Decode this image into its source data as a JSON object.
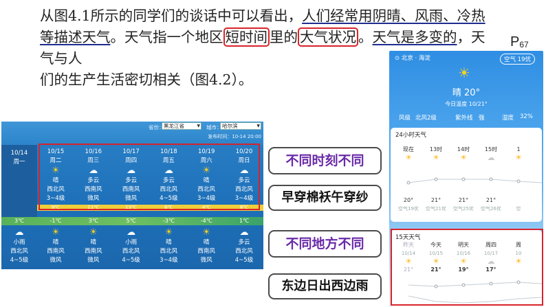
{
  "paragraph": {
    "s1": "从图4.1所示的同学们的谈话中可以看出，",
    "s1_ul": "人们经常用阴晴、风雨、冷热",
    "s2_ul": "等描述天气",
    "s2": "。天气指一个地区",
    "box1": "短时间",
    "s3": "里的",
    "box2": "大气状况",
    "s4": "。",
    "s4_ul": "天气是多变的",
    "s5": "，天气与人",
    "s6": "们的生产生活密切相关（图4.2）。"
  },
  "page_number": {
    "p": "P",
    "sub": "67"
  },
  "forecast": {
    "province_label": "省份：",
    "province_value": "黑龙江省",
    "city_label": "城市：",
    "city_value": "哈尔滨",
    "publish_time": "发布时间：10-14 20:00",
    "today": {
      "date": "10/14",
      "weekday": "周一"
    },
    "days": [
      {
        "date": "10/15",
        "weekday": "周二",
        "icon": "sun-icon",
        "weather": "晴",
        "wind": "西北风",
        "level": "3~4级",
        "high": "9℃",
        "low": "-1℃",
        "n_icon": "sun-icon",
        "n_weather": "晴",
        "n_wind": "西南风",
        "n_level": "微风"
      },
      {
        "date": "10/16",
        "weekday": "周三",
        "icon": "cloud-icon",
        "weather": "多云",
        "wind": "西南风",
        "level": "微风",
        "high": "11℃",
        "low": "3℃",
        "n_icon": "sun-icon",
        "n_weather": "晴",
        "n_wind": "西南风",
        "n_level": "微风"
      },
      {
        "date": "10/17",
        "weekday": "周四",
        "icon": "cloud-icon",
        "weather": "多云",
        "wind": "西南风",
        "level": "微风",
        "high": "13℃",
        "low": "5℃",
        "n_icon": "cloud-icon",
        "n_weather": "小雨",
        "n_wind": "西北风",
        "n_level": "4~5级"
      },
      {
        "date": "10/18",
        "weekday": "周五",
        "icon": "cloud-icon",
        "weather": "多云",
        "wind": "西北风",
        "level": "4~5级",
        "high": "6℃",
        "low": "-3℃",
        "n_icon": "sun-icon",
        "n_weather": "晴",
        "n_wind": "西北风",
        "n_level": "3~4级"
      },
      {
        "date": "10/19",
        "weekday": "周六",
        "icon": "sun-icon",
        "weather": "晴",
        "wind": "西北风",
        "level": "3~4级",
        "high": "4℃",
        "low": "-4℃",
        "n_icon": "sun-icon",
        "n_weather": "晴",
        "n_wind": "西南风",
        "n_level": "微风"
      },
      {
        "date": "10/20",
        "weekday": "周日",
        "icon": "cloud-icon",
        "weather": "多云",
        "wind": "西北风",
        "level": "3~4级",
        "high": "8℃",
        "low": "1℃",
        "n_icon": "cloud-icon",
        "n_weather": "多云",
        "n_wind": "西北风",
        "n_level": "4~5级"
      }
    ],
    "today_low": "3℃",
    "today_night": {
      "icon": "cloud-icon",
      "weather": "小雨",
      "wind": "西北风",
      "level": "4~5级"
    }
  },
  "labels": {
    "time_diff": "不同时刻不同",
    "saying1": "早穿棉袄午穿纱",
    "place_diff": "不同地方不同",
    "saying2": "东边日出西边雨"
  },
  "phone": {
    "location": "北京 · 海淀",
    "aqi_badge": "空气 19优",
    "current": "晴 20°",
    "today_range": "今日温度 10/21°",
    "wind_label": "风级",
    "wind_value": "北风2级",
    "uv_label": "紫外线",
    "uv_value": "强",
    "humidity_label": "湿度",
    "humidity_value": "32%",
    "hourly_title": "24小时天气",
    "hourly": [
      {
        "time": "现在",
        "icon": "sun-icon",
        "temp": "20°",
        "aqi": "空气19优"
      },
      {
        "time": "13时",
        "icon": "sun-icon",
        "temp": "21°",
        "aqi": "空气21优"
      },
      {
        "time": "14时",
        "icon": "sun-icon",
        "temp": "21°",
        "aqi": "空气25优"
      },
      {
        "time": "15时",
        "icon": "cloud-icon",
        "temp": "21°",
        "aqi": "空气26优"
      },
      {
        "time": "1",
        "icon": "sun-icon",
        "temp": "",
        "aqi": "空"
      }
    ],
    "daily_title": "15天天气",
    "daily": [
      {
        "day": "昨天",
        "date": "10/14",
        "icon": "sun-icon",
        "temp": "21°"
      },
      {
        "day": "今天",
        "date": "10/15",
        "icon": "sun-icon",
        "temp": "21°"
      },
      {
        "day": "明天",
        "date": "10/16",
        "icon": "sun-icon",
        "temp": "19°"
      },
      {
        "day": "周四",
        "date": "10/17",
        "icon": "cloud-icon",
        "temp": "17°"
      },
      {
        "day": "周",
        "date": "10",
        "icon": "sun-icon",
        "temp": ""
      }
    ]
  }
}
